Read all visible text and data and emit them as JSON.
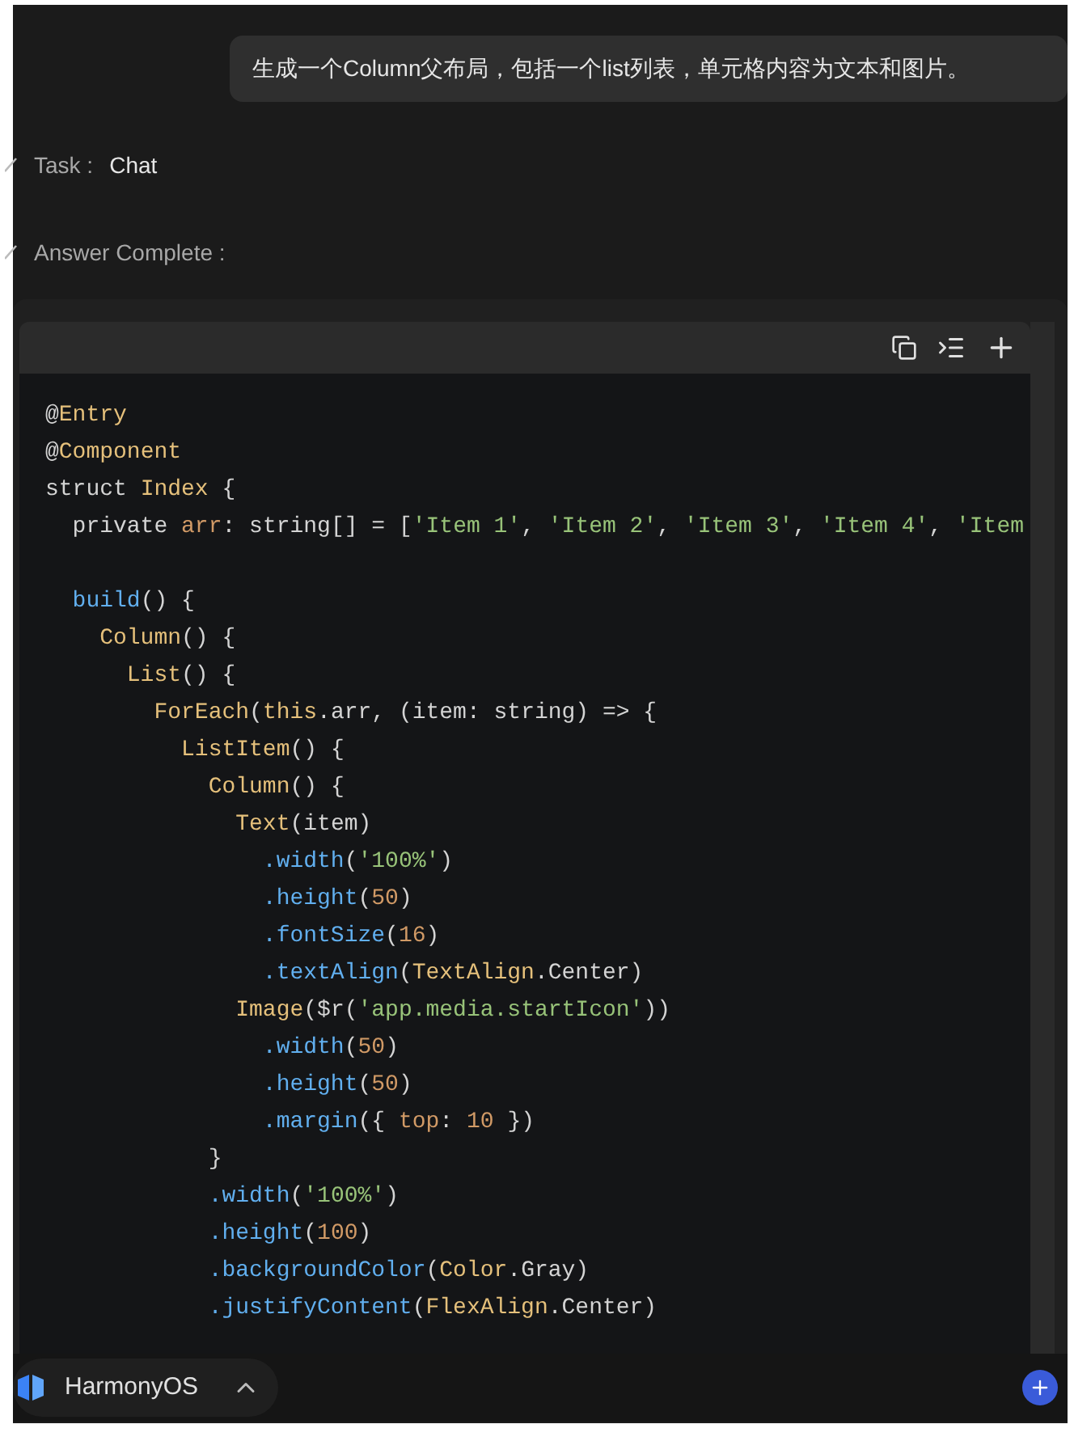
{
  "prompt": "生成一个Column父布局，包括一个list列表，单元格内容为文本和图片。",
  "status": [
    {
      "label": "Task :",
      "value": "Chat"
    },
    {
      "label": "Answer Complete :"
    }
  ],
  "code_block": {
    "lines": [
      {
        "kind": "code",
        "tokens": [
          {
            "kind": "plain",
            "text": "@"
          },
          {
            "kind": "type",
            "text": "Entry"
          }
        ]
      },
      {
        "kind": "code",
        "tokens": [
          {
            "kind": "plain",
            "text": "@"
          },
          {
            "kind": "type",
            "text": "Component"
          }
        ]
      },
      {
        "kind": "code",
        "tokens": [
          {
            "kind": "plain",
            "text": "struct "
          },
          {
            "kind": "type",
            "text": "Index"
          },
          {
            "kind": "plain",
            "text": " {"
          }
        ]
      },
      {
        "kind": "code",
        "tokens": [
          {
            "kind": "plain",
            "text": "  private "
          },
          {
            "kind": "number",
            "text": "arr"
          },
          {
            "kind": "plain",
            "text": ": string[] = ["
          },
          {
            "kind": "string",
            "text": "'Item 1'"
          },
          {
            "kind": "plain",
            "text": ", "
          },
          {
            "kind": "string",
            "text": "'Item 2'"
          },
          {
            "kind": "plain",
            "text": ", "
          },
          {
            "kind": "string",
            "text": "'Item 3'"
          },
          {
            "kind": "plain",
            "text": ", "
          },
          {
            "kind": "string",
            "text": "'Item 4'"
          },
          {
            "kind": "plain",
            "text": ", "
          },
          {
            "kind": "string",
            "text": "'Item"
          }
        ]
      },
      {
        "kind": "blank"
      },
      {
        "kind": "code",
        "tokens": [
          {
            "kind": "method",
            "text": "  build"
          },
          {
            "kind": "plain",
            "text": "() {"
          }
        ]
      },
      {
        "kind": "code",
        "tokens": [
          {
            "kind": "type",
            "text": "    Column"
          },
          {
            "kind": "plain",
            "text": "() {"
          }
        ]
      },
      {
        "kind": "code",
        "tokens": [
          {
            "kind": "type",
            "text": "      List"
          },
          {
            "kind": "plain",
            "text": "() {"
          }
        ]
      },
      {
        "kind": "code",
        "tokens": [
          {
            "kind": "type",
            "text": "        ForEach"
          },
          {
            "kind": "plain",
            "text": "("
          },
          {
            "kind": "type",
            "text": "this"
          },
          {
            "kind": "plain",
            "text": ".arr, (item: string) => {"
          }
        ]
      },
      {
        "kind": "code",
        "tokens": [
          {
            "kind": "type",
            "text": "          ListItem"
          },
          {
            "kind": "plain",
            "text": "() {"
          }
        ]
      },
      {
        "kind": "code",
        "tokens": [
          {
            "kind": "type",
            "text": "            Column"
          },
          {
            "kind": "plain",
            "text": "() {"
          }
        ]
      },
      {
        "kind": "code",
        "tokens": [
          {
            "kind": "type",
            "text": "              Text"
          },
          {
            "kind": "plain",
            "text": "(item)"
          }
        ]
      },
      {
        "kind": "code",
        "tokens": [
          {
            "kind": "method",
            "text": "                .width"
          },
          {
            "kind": "plain",
            "text": "("
          },
          {
            "kind": "string",
            "text": "'100%'"
          },
          {
            "kind": "plain",
            "text": ")"
          }
        ]
      },
      {
        "kind": "code",
        "tokens": [
          {
            "kind": "method",
            "text": "                .height"
          },
          {
            "kind": "plain",
            "text": "("
          },
          {
            "kind": "number",
            "text": "50"
          },
          {
            "kind": "plain",
            "text": ")"
          }
        ]
      },
      {
        "kind": "code",
        "tokens": [
          {
            "kind": "method",
            "text": "                .fontSize"
          },
          {
            "kind": "plain",
            "text": "("
          },
          {
            "kind": "number",
            "text": "16"
          },
          {
            "kind": "plain",
            "text": ")"
          }
        ]
      },
      {
        "kind": "code",
        "tokens": [
          {
            "kind": "method",
            "text": "                .textAlign"
          },
          {
            "kind": "plain",
            "text": "("
          },
          {
            "kind": "type",
            "text": "TextAlign"
          },
          {
            "kind": "plain",
            "text": ".Center)"
          }
        ]
      },
      {
        "kind": "code",
        "tokens": [
          {
            "kind": "type",
            "text": "              Image"
          },
          {
            "kind": "plain",
            "text": "($r("
          },
          {
            "kind": "string",
            "text": "'app.media.startIcon'"
          },
          {
            "kind": "plain",
            "text": "))"
          }
        ]
      },
      {
        "kind": "code",
        "tokens": [
          {
            "kind": "method",
            "text": "                .width"
          },
          {
            "kind": "plain",
            "text": "("
          },
          {
            "kind": "number",
            "text": "50"
          },
          {
            "kind": "plain",
            "text": ")"
          }
        ]
      },
      {
        "kind": "code",
        "tokens": [
          {
            "kind": "method",
            "text": "                .height"
          },
          {
            "kind": "plain",
            "text": "("
          },
          {
            "kind": "number",
            "text": "50"
          },
          {
            "kind": "plain",
            "text": ")"
          }
        ]
      },
      {
        "kind": "code",
        "tokens": [
          {
            "kind": "method",
            "text": "                .margin"
          },
          {
            "kind": "plain",
            "text": "({ "
          },
          {
            "kind": "number",
            "text": "top"
          },
          {
            "kind": "plain",
            "text": ": "
          },
          {
            "kind": "number",
            "text": "10"
          },
          {
            "kind": "plain",
            "text": " })"
          }
        ]
      },
      {
        "kind": "code",
        "tokens": [
          {
            "kind": "plain",
            "text": "            }"
          }
        ]
      },
      {
        "kind": "code",
        "tokens": [
          {
            "kind": "method",
            "text": "            .width"
          },
          {
            "kind": "plain",
            "text": "("
          },
          {
            "kind": "string",
            "text": "'100%'"
          },
          {
            "kind": "plain",
            "text": ")"
          }
        ]
      },
      {
        "kind": "code",
        "tokens": [
          {
            "kind": "method",
            "text": "            .height"
          },
          {
            "kind": "plain",
            "text": "("
          },
          {
            "kind": "number",
            "text": "100"
          },
          {
            "kind": "plain",
            "text": ")"
          }
        ]
      },
      {
        "kind": "code",
        "tokens": [
          {
            "kind": "method",
            "text": "            .backgroundColor"
          },
          {
            "kind": "plain",
            "text": "("
          },
          {
            "kind": "type",
            "text": "Color"
          },
          {
            "kind": "plain",
            "text": ".Gray)"
          }
        ]
      },
      {
        "kind": "code",
        "tokens": [
          {
            "kind": "method",
            "text": "            .justifyContent"
          },
          {
            "kind": "plain",
            "text": "("
          },
          {
            "kind": "type",
            "text": "FlexAlign"
          },
          {
            "kind": "plain",
            "text": ".Center)"
          }
        ]
      }
    ]
  },
  "bottom_bar": {
    "workspace": "HarmonyOS"
  }
}
